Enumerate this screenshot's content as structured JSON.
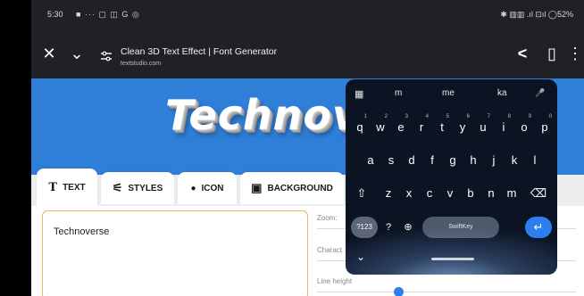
{
  "status": {
    "time": "5:30",
    "left_icons": "■ ··· ▢ ◫ G ◎",
    "right_icons": "✱ ▥▥ .ıl ⊡ıl ◯52%"
  },
  "toolbar": {
    "close_glyph": "✕",
    "expand_glyph": "⌄",
    "title": "Clean 3D Text Effect | Font Generator",
    "url": "textstudio.com",
    "share_glyph": "<",
    "bookmark_glyph": "▯",
    "menu_glyph": "⋮"
  },
  "banner": {
    "logo_text": "Technov"
  },
  "tabs": [
    {
      "icon": "T",
      "label": "TEXT"
    },
    {
      "icon": "⚟",
      "label": "STYLES"
    },
    {
      "icon": "●",
      "label": "ICON"
    },
    {
      "icon": "▣",
      "label": "BACKGROUND"
    }
  ],
  "editor": {
    "text_value": "Technoverse",
    "zoom_label": "Zoom:",
    "character_label": "Charact",
    "line_height_label": "Line height"
  },
  "keyboard": {
    "toolbar": [
      "m",
      "me",
      "ka"
    ],
    "grid_glyph": "▦",
    "mic_glyph": "🎤",
    "row1": [
      {
        "k": "q",
        "n": "1"
      },
      {
        "k": "w",
        "n": "2"
      },
      {
        "k": "e",
        "n": "3"
      },
      {
        "k": "r",
        "n": "4"
      },
      {
        "k": "t",
        "n": "5"
      },
      {
        "k": "y",
        "n": "6"
      },
      {
        "k": "u",
        "n": "7"
      },
      {
        "k": "i",
        "n": "8"
      },
      {
        "k": "o",
        "n": "9"
      },
      {
        "k": "p",
        "n": "0"
      }
    ],
    "row2": [
      "a",
      "s",
      "d",
      "f",
      "g",
      "h",
      "j",
      "k",
      "l"
    ],
    "row3": [
      "z",
      "x",
      "c",
      "v",
      "b",
      "n",
      "m"
    ],
    "shift_glyph": "⇧",
    "backspace_glyph": "⌫",
    "mode_label": "?123",
    "comma_glyph": "?",
    "globe_glyph": "⊕",
    "space_label": "SwiftKey",
    "enter_glyph": "↵",
    "collapse_glyph": "⌄"
  }
}
